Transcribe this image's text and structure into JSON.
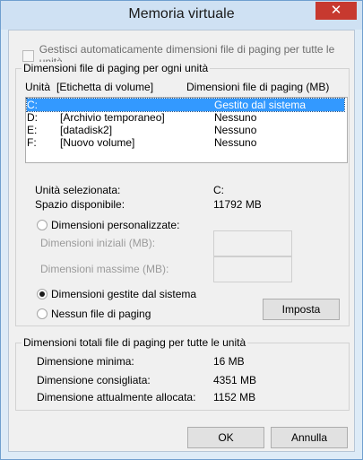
{
  "window": {
    "title": "Memoria virtuale",
    "close_glyph": "✕"
  },
  "auto_manage": {
    "label": "Gestisci automaticamente dimensioni file di paging per tutte le unità",
    "checked": false
  },
  "per_drive": {
    "group_title": "Dimensioni file di paging per ogni unità",
    "headers": {
      "drive": "Unità",
      "volume_label": "[Etichetta di volume]",
      "paging_size": "Dimensioni file di paging (MB)"
    },
    "rows": [
      {
        "drive": "C:",
        "label": "",
        "size": "Gestito dal sistema",
        "selected": true
      },
      {
        "drive": "D:",
        "label": "[Archivio temporaneo]",
        "size": "Nessuno",
        "selected": false
      },
      {
        "drive": "E:",
        "label": "[datadisk2]",
        "size": "Nessuno",
        "selected": false
      },
      {
        "drive": "F:",
        "label": "[Nuovo volume]",
        "size": "Nessuno",
        "selected": false
      }
    ],
    "selected_drive_label": "Unità selezionata:",
    "selected_drive_value": "C:",
    "free_space_label": "Spazio disponibile:",
    "free_space_value": "11792 MB",
    "custom_size_label": "Dimensioni personalizzate:",
    "initial_size_label": "Dimensioni iniziali (MB):",
    "initial_size_value": "",
    "max_size_label": "Dimensioni massime (MB):",
    "max_size_value": "",
    "system_managed_label": "Dimensioni gestite dal sistema",
    "no_paging_label": "Nessun file di paging",
    "selected_option": "system_managed",
    "set_button": "Imposta"
  },
  "totals": {
    "group_title": "Dimensioni totali file di paging per tutte le unità",
    "min_label": "Dimensione minima:",
    "min_value": "16 MB",
    "recommended_label": "Dimensione consigliata:",
    "recommended_value": "4351 MB",
    "allocated_label": "Dimensione attualmente allocata:",
    "allocated_value": "1152 MB"
  },
  "footer": {
    "ok": "OK",
    "cancel": "Annulla"
  },
  "colors": {
    "selection": "#3399ff",
    "close_button": "#c7392f",
    "title_bar": "#cfe1f3"
  }
}
